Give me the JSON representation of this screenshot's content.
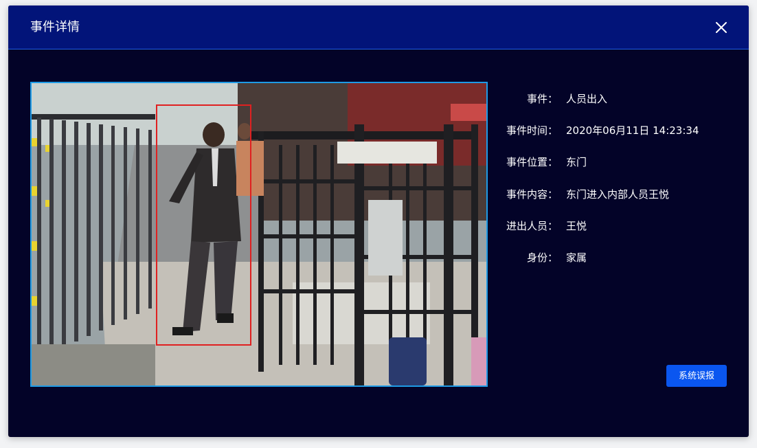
{
  "dialog": {
    "title": "事件详情",
    "close_icon": "close-icon"
  },
  "details": [
    {
      "label": "事件：",
      "value": "人员出入"
    },
    {
      "label": "事件时间：",
      "value": "2020年06月11日 14:23:34"
    },
    {
      "label": "事件位置：",
      "value": "东门"
    },
    {
      "label": "事件内容：",
      "value": "东门进入内部人员王悦"
    },
    {
      "label": "进出人员：",
      "value": "王悦"
    },
    {
      "label": "身份：",
      "value": "家属"
    }
  ],
  "actions": {
    "report_label": "系统误报"
  },
  "colors": {
    "background": "#030328",
    "header": "#021479",
    "image_border": "#1e9be6",
    "detection_box": "#e02020",
    "button": "#0a56f0"
  }
}
